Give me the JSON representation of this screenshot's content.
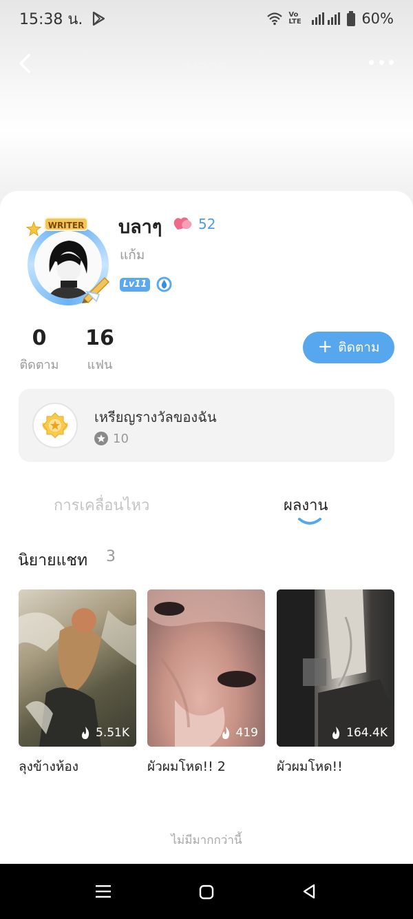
{
  "status_bar": {
    "time": "15:38 น.",
    "battery": "60%",
    "volte_label": "Vo LTE"
  },
  "nav": {
    "title": "บลาๆ"
  },
  "profile": {
    "name": "บลาๆ",
    "heart_count": "52",
    "subname": "แก้ม",
    "level_badge": "Lv11",
    "frame_badge": "WRITER"
  },
  "stats": {
    "following_count": "0",
    "following_label": "ติดตาม",
    "fans_count": "16",
    "fans_label": "แฟน"
  },
  "follow_button": {
    "label": "ติดตาม"
  },
  "medals": {
    "title": "เหรียญรางวัลของฉัน",
    "count": "10"
  },
  "tabs": {
    "activity": "การเคลื่อนไหว",
    "works": "ผลงาน",
    "active": "works"
  },
  "section": {
    "title": "นิยายแชท",
    "count": "3"
  },
  "books": [
    {
      "title": "ลุงข้างห้อง",
      "views": "5.51K"
    },
    {
      "title": "ผัวผมโหด!! 2",
      "views": "419"
    },
    {
      "title": "ผัวผมโหด!!",
      "views": "164.4K"
    }
  ],
  "footer": {
    "end_text": "ไม่มีมากกว่านี้"
  },
  "colors": {
    "accent": "#56a7ee",
    "heart": "#f06a8a",
    "text_muted": "#999999"
  }
}
